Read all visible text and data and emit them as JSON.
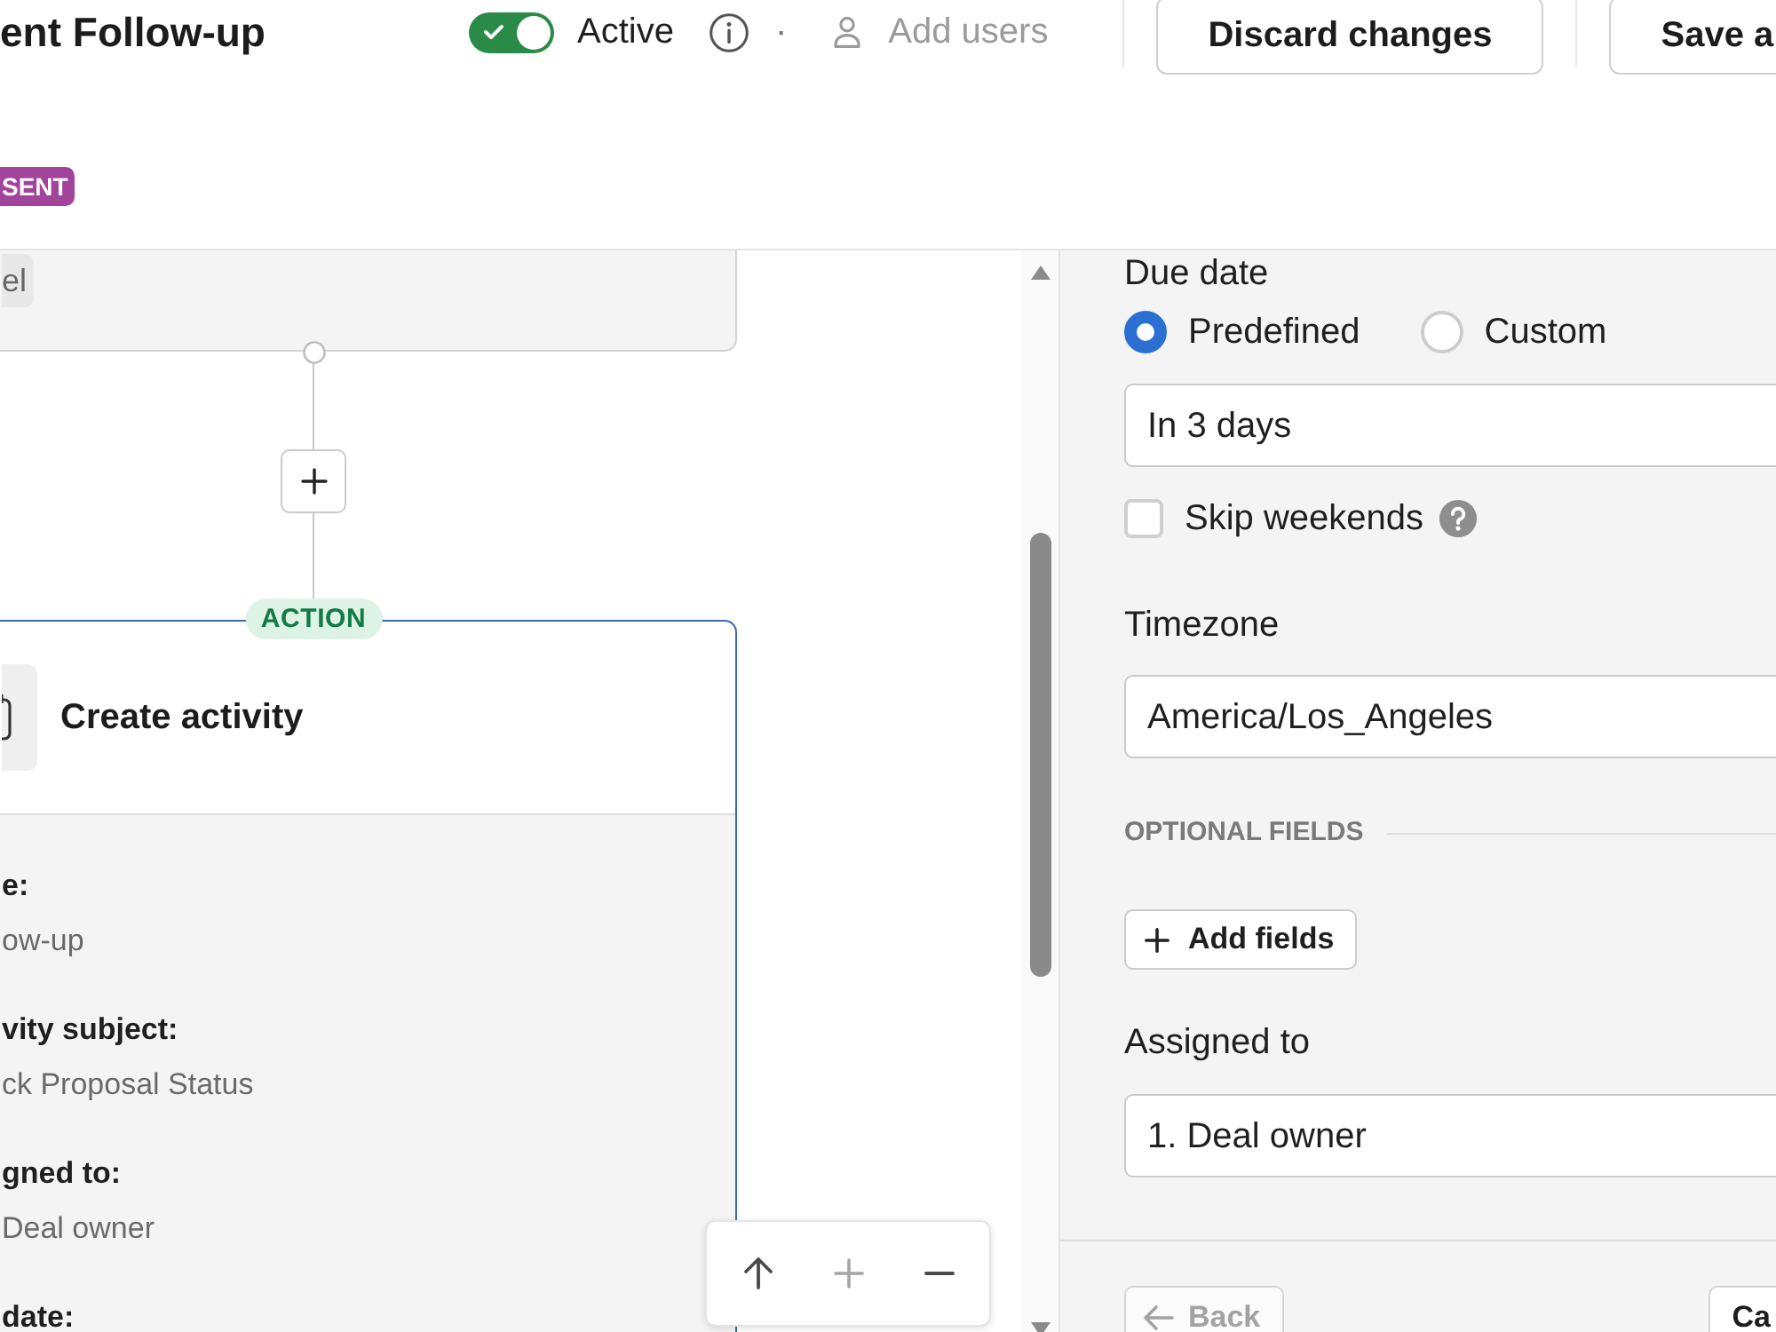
{
  "header": {
    "title": "ent Follow-up",
    "status": {
      "on": true,
      "label": "Active"
    },
    "separator": "·",
    "add_users": {
      "label": "Add users",
      "disabled": true
    },
    "buttons": [
      "Discard changes",
      "Save a"
    ],
    "badge": "SENT"
  },
  "canvas": {
    "nodes": [
      {
        "kind": "trigger",
        "selected": false,
        "chips": [
          "el"
        ]
      },
      {
        "kind": "action",
        "selected": true,
        "tag": "ACTION",
        "title": "Create activity",
        "fields": [
          {
            "label": "e:",
            "value": "ow-up"
          },
          {
            "label": "vity subject:",
            "value": "ck Proposal Status"
          },
          {
            "label": "gned to:",
            "value": "Deal owner"
          },
          {
            "label": "date:"
          }
        ]
      }
    ],
    "zoom_controls": [
      {
        "kind": "up",
        "disabled": false
      },
      {
        "kind": "zoom_in",
        "disabled": true
      },
      {
        "kind": "zoom_out",
        "disabled": false
      }
    ]
  },
  "panel": {
    "due_date": {
      "label": "Due date",
      "options": [
        {
          "label": "Predefined",
          "selected": true
        },
        {
          "label": "Custom",
          "selected": false
        }
      ],
      "value": "In 3 days",
      "skip_weekends": {
        "label": "Skip weekends",
        "checked": false
      }
    },
    "timezone": {
      "label": "Timezone",
      "value": "America/Los_Angeles"
    },
    "optional_fields": {
      "heading": "OPTIONAL FIELDS",
      "button": "Add fields"
    },
    "assigned_to": {
      "label": "Assigned to",
      "value": "1. Deal owner"
    },
    "footer": {
      "back": {
        "label": "Back",
        "disabled": true
      },
      "next": {
        "label": "Ca"
      }
    }
  }
}
